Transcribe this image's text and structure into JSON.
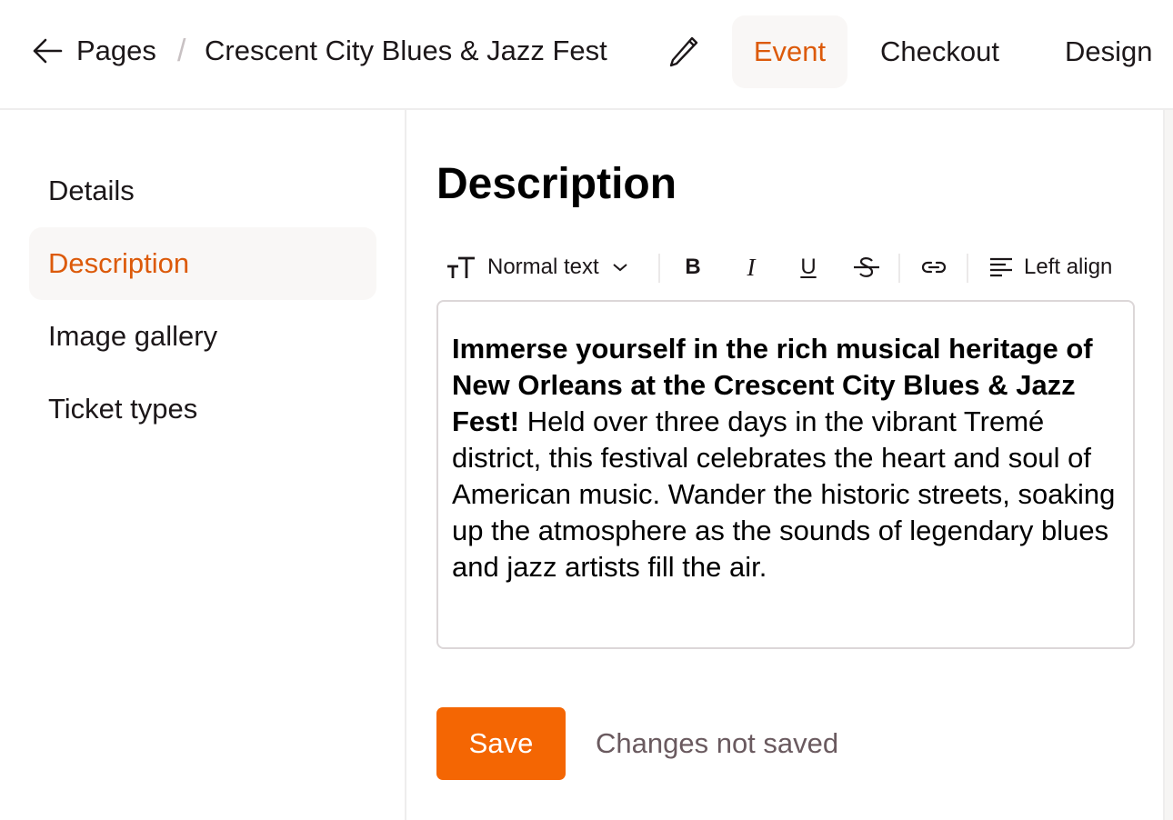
{
  "header": {
    "back_icon": "arrow-left-icon",
    "breadcrumb_root": "Pages",
    "breadcrumb_separator": "/",
    "page_title": "Crescent City Blues & Jazz Fest",
    "edit_icon": "pencil-icon",
    "tabs": [
      {
        "label": "Event",
        "active": true
      },
      {
        "label": "Checkout",
        "active": false
      },
      {
        "label": "Design",
        "active": false
      }
    ]
  },
  "sidebar": {
    "items": [
      {
        "label": "Details",
        "active": false
      },
      {
        "label": "Description",
        "active": true
      },
      {
        "label": "Image gallery",
        "active": false
      },
      {
        "label": "Ticket types",
        "active": false
      }
    ]
  },
  "main": {
    "heading": "Description",
    "toolbar": {
      "text_style_icon": "text-size-icon",
      "text_style_value": "Normal text",
      "dropdown_icon": "chevron-down-icon",
      "bold_icon": "bold-icon",
      "italic_icon": "italic-icon",
      "underline_icon": "underline-icon",
      "strikethrough_icon": "strikethrough-icon",
      "link_icon": "link-icon",
      "align_icon": "align-left-icon",
      "align_label": "Left align"
    },
    "editor": {
      "bold_text": "Immerse yourself in the rich musical heritage of New Orleans at the Crescent City Blues & Jazz Fest!",
      "body_text": " Held over three days in the vibrant Tremé district, this festival celebrates the heart and soul of American music. Wander the historic streets, soaking up the atmosphere as the sounds of legendary blues and jazz artists fill the air."
    },
    "save_label": "Save",
    "save_status": "Changes not saved"
  },
  "colors": {
    "accent": "#dc5a0a",
    "button": "#f46603",
    "active_bg": "#f9f7f6",
    "status_text": "#6a5a5f"
  }
}
